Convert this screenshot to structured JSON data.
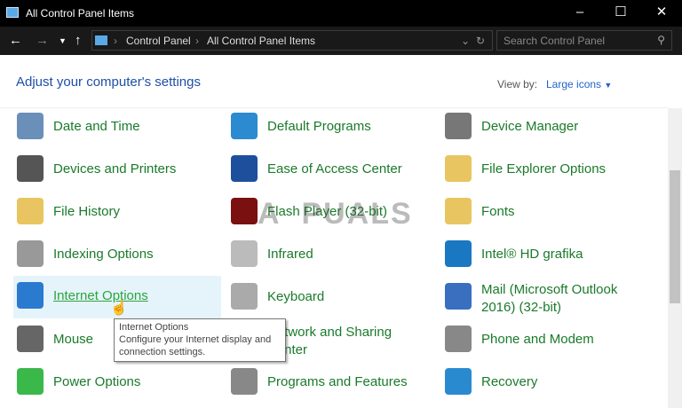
{
  "window": {
    "title": "All Control Panel Items"
  },
  "nav": {
    "breadcrumb": [
      "Control Panel",
      "All Control Panel Items"
    ],
    "search_placeholder": "Search Control Panel"
  },
  "header": {
    "title": "Adjust your computer's settings",
    "view_by_label": "View by:",
    "view_by_value": "Large icons"
  },
  "items": [
    {
      "label": "Date and Time",
      "icon": "clock-calendar-icon",
      "color": "#6a8fb8"
    },
    {
      "label": "Default Programs",
      "icon": "default-programs-icon",
      "color": "#2b8ad0"
    },
    {
      "label": "Device Manager",
      "icon": "device-manager-icon",
      "color": "#777777"
    },
    {
      "label": "Devices and Printers",
      "icon": "printer-icon",
      "color": "#555555"
    },
    {
      "label": "Ease of Access Center",
      "icon": "ease-of-access-icon",
      "color": "#1d4f9c"
    },
    {
      "label": "File Explorer Options",
      "icon": "folder-options-icon",
      "color": "#e8c560"
    },
    {
      "label": "File History",
      "icon": "file-history-icon",
      "color": "#e8c560"
    },
    {
      "label": "Flash Player (32-bit)",
      "icon": "flash-icon",
      "color": "#7a1010"
    },
    {
      "label": "Fonts",
      "icon": "fonts-icon",
      "color": "#e8c560"
    },
    {
      "label": "Indexing Options",
      "icon": "indexing-icon",
      "color": "#999999"
    },
    {
      "label": "Infrared",
      "icon": "infrared-icon",
      "color": "#bbbbbb"
    },
    {
      "label": "Intel® HD grafika",
      "icon": "intel-graphics-icon",
      "color": "#1a78c2"
    },
    {
      "label": "Internet Options",
      "icon": "globe-icon",
      "color": "#2a7ad0"
    },
    {
      "label": "Keyboard",
      "icon": "keyboard-icon",
      "color": "#aaaaaa"
    },
    {
      "label": "Mail (Microsoft Outlook 2016) (32-bit)",
      "icon": "mail-icon",
      "color": "#3a6fbf"
    },
    {
      "label": "Mouse",
      "icon": "mouse-icon",
      "color": "#666666"
    },
    {
      "label": "Network and Sharing Center",
      "icon": "network-icon",
      "color": "#3a6fbf"
    },
    {
      "label": "Phone and Modem",
      "icon": "phone-icon",
      "color": "#888888"
    },
    {
      "label": "Power Options",
      "icon": "battery-icon",
      "color": "#3bb84a"
    },
    {
      "label": "Programs and Features",
      "icon": "programs-features-icon",
      "color": "#888888"
    },
    {
      "label": "Recovery",
      "icon": "recovery-icon",
      "color": "#2a8ad0"
    }
  ],
  "tooltip": {
    "title": "Internet Options",
    "text": "Configure your Internet display and connection settings."
  },
  "watermark": "APPUALS"
}
